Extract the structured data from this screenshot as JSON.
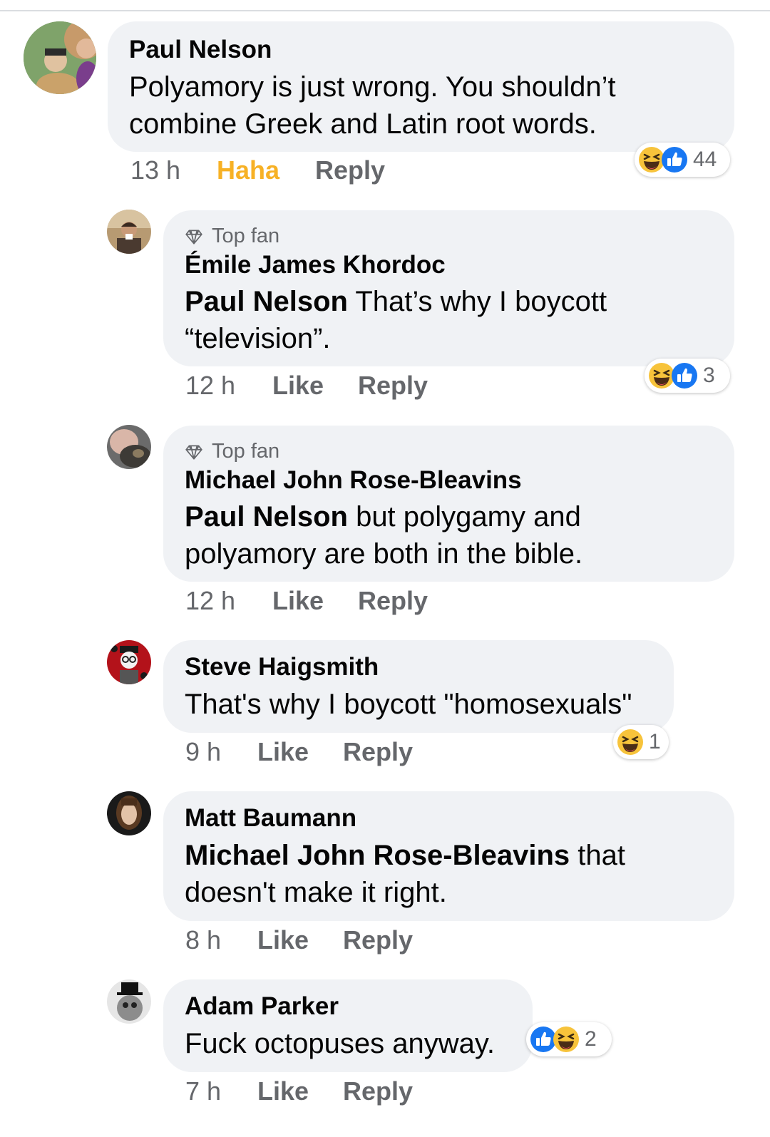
{
  "comments": [
    {
      "author": "Paul Nelson",
      "text": "Polyamory is just wrong.  You shouldn’t",
      "text2": "combine Greek and Latin root words.",
      "time": "13 h",
      "reaction_label": "Haha",
      "reply": "Reply",
      "reaction_count": "44",
      "reaction_icons": [
        "haha-icon",
        "like-icon"
      ]
    },
    {
      "badge": "Top fan",
      "author": "Émile James Khordoc",
      "mention": "Paul Nelson",
      "text": " That’s why I boycott",
      "text2": "“television”.",
      "time": "12 h",
      "like": "Like",
      "reply": "Reply",
      "reaction_count": "3",
      "reaction_icons": [
        "haha-icon",
        "like-icon"
      ]
    },
    {
      "badge": "Top fan",
      "author": "Michael John Rose-Bleavins",
      "mention": "Paul Nelson",
      "text": " but polygamy and",
      "text2": "polyamory are both in the bible.",
      "time": "12 h",
      "like": "Like",
      "reply": "Reply"
    },
    {
      "author": "Steve Haigsmith",
      "text": "That's why I boycott \"homosexuals\"",
      "time": "9 h",
      "like": "Like",
      "reply": "Reply",
      "reaction_count": "1",
      "reaction_icons": [
        "haha-icon"
      ]
    },
    {
      "author": "Matt Baumann",
      "mention": "Michael John Rose-Bleavins",
      "text": " that",
      "text2": "doesn't make it right.",
      "time": "8 h",
      "like": "Like",
      "reply": "Reply"
    },
    {
      "author": "Adam Parker",
      "text": "Fuck octopuses anyway.",
      "time": "7 h",
      "like": "Like",
      "reply": "Reply",
      "reaction_count": "2",
      "reaction_icons": [
        "like-icon",
        "haha-icon"
      ]
    }
  ],
  "colors": {
    "bubble": "#f0f2f5",
    "secondary_text": "#65676b",
    "haha": "#f7b125",
    "like_blue": "#1877f2"
  }
}
